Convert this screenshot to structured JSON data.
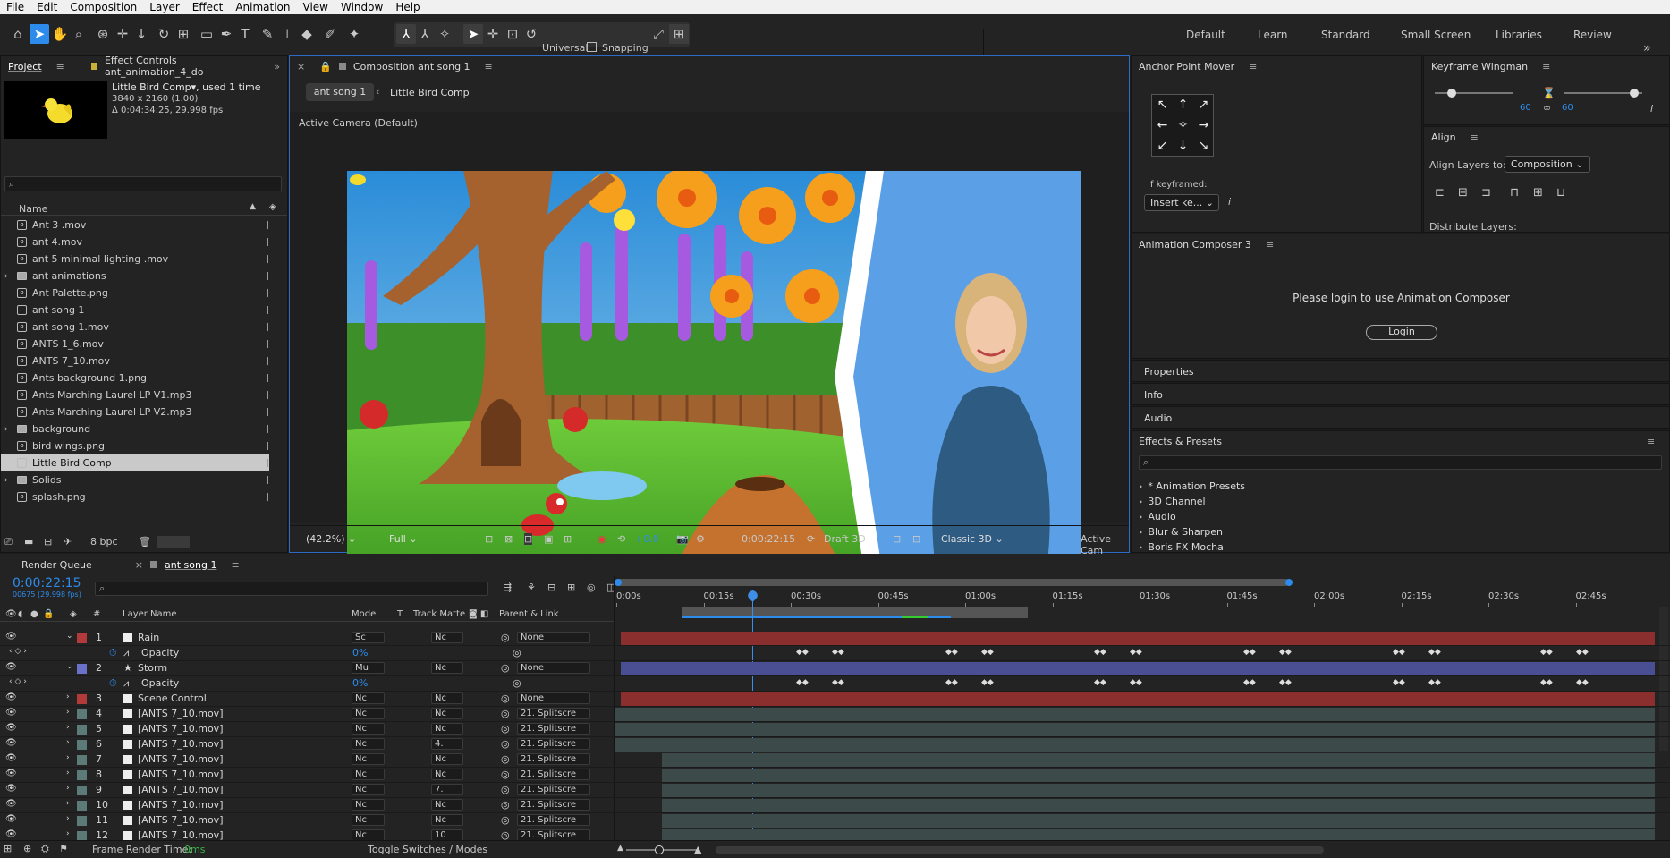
{
  "menu": [
    "File",
    "Edit",
    "Composition",
    "Layer",
    "Effect",
    "Animation",
    "View",
    "Window",
    "Help"
  ],
  "toolbar": {
    "universal_label": "Universal",
    "snapping_label": "Snapping",
    "workspaces": [
      "Default",
      "Learn",
      "Standard",
      "Small Screen",
      "Libraries",
      "Review"
    ]
  },
  "project": {
    "tab_project": "Project",
    "tab_effect_controls": "Effect Controls ant_animation_4_do",
    "comp_name": "Little Bird Comp▾, used 1 time",
    "comp_res": "3840 x 2160 (1.00)",
    "comp_dur": "Δ 0:04:34:25, 29.998 fps",
    "search_placeholder": "",
    "col_name": "Name",
    "items": [
      {
        "name": "Ant 3 .mov",
        "type": "file"
      },
      {
        "name": "ant 4.mov",
        "type": "file"
      },
      {
        "name": "ant 5 minimal lighting .mov",
        "type": "file"
      },
      {
        "name": "ant animations",
        "type": "folder"
      },
      {
        "name": "Ant Palette.png",
        "type": "file"
      },
      {
        "name": "ant song 1",
        "type": "comp"
      },
      {
        "name": "ant song 1.mov",
        "type": "file"
      },
      {
        "name": "ANTS 1_6.mov",
        "type": "file"
      },
      {
        "name": "ANTS 7_10.mov",
        "type": "file"
      },
      {
        "name": "Ants background 1.png",
        "type": "file"
      },
      {
        "name": "Ants Marching Laurel LP V1.mp3",
        "type": "file"
      },
      {
        "name": "Ants Marching Laurel LP V2.mp3",
        "type": "file"
      },
      {
        "name": "background",
        "type": "folder"
      },
      {
        "name": "bird wings.png",
        "type": "file"
      },
      {
        "name": "Little Bird Comp",
        "type": "comp",
        "selected": true
      },
      {
        "name": "Solids",
        "type": "folder"
      },
      {
        "name": "splash.png",
        "type": "file"
      }
    ],
    "bpc": "8 bpc"
  },
  "composition": {
    "tab_label": "Composition ant song 1",
    "breadcrumb_active": "ant song 1",
    "breadcrumb_next": "Little Bird Comp",
    "camera_label": "Active Camera (Default)",
    "zoom": "(42.2%)",
    "resolution": "Full",
    "exposure": "+0.0",
    "timecode": "0:00:22:15",
    "draft": "Draft 3D",
    "renderer": "Classic 3D",
    "view": "Active Cam"
  },
  "anchor_point": {
    "title": "Anchor Point Mover",
    "if_keyframed": "If keyframed:",
    "insert_option": "Insert ke..."
  },
  "keyframe_wingman": {
    "title": "Keyframe Wingman",
    "left_value": "60",
    "right_value": "60",
    "left_fraction": 0.22,
    "right_fraction": 0.9
  },
  "align": {
    "title": "Align",
    "align_to_label": "Align Layers to:",
    "align_to_value": "Composition",
    "distribute_label": "Distribute Layers:"
  },
  "animation_composer": {
    "title": "Animation Composer 3",
    "message": "Please login to use Animation Composer",
    "login": "Login"
  },
  "side_panels": [
    "Properties",
    "Info",
    "Audio"
  ],
  "effects_presets": {
    "title": "Effects & Presets",
    "items": [
      "* Animation Presets",
      "3D Channel",
      "Audio",
      "Blur & Sharpen",
      "Boris FX Mocha"
    ]
  },
  "timeline": {
    "tab_render_queue": "Render Queue",
    "tab_comp": "ant song 1",
    "timecode": "0:00:22:15",
    "frame_info": "00675 (29.998 fps)",
    "col_layer_name": "Layer Name",
    "col_mode": "Mode",
    "col_t": "T",
    "col_track_matte": "Track Matte",
    "col_parent": "Parent & Link",
    "col_hash": "#",
    "ruler": [
      "0:00s",
      "00:15s",
      "00:30s",
      "00:45s",
      "01:00s",
      "01:15s",
      "01:30s",
      "01:45s",
      "02:00s",
      "02:15s",
      "02:30s",
      "02:45s"
    ],
    "footer_render_time_label": "Frame Render Time:",
    "footer_render_time_value": "0ms",
    "footer_toggle": "Toggle Switches / Modes",
    "layers": [
      {
        "num": "1",
        "name": "Rain",
        "mode": "Sc",
        "matte": "Nc",
        "parent": "None",
        "color": "#b23a3a",
        "bar": "#8a2e2e",
        "expanded": true,
        "prop": "Opacity",
        "prop_value": "0%"
      },
      {
        "num": "2",
        "name": "Storm",
        "mode": "Mu",
        "matte": "Nc",
        "parent": "None",
        "color": "#6b70c9",
        "bar": "#4a4f93",
        "expanded": true,
        "prop": "Opacity",
        "prop_value": "0%",
        "star": true
      },
      {
        "num": "3",
        "name": "Scene Control",
        "mode": "Nc",
        "matte": "Nc",
        "parent": "None",
        "color": "#b23a3a",
        "bar": "#8a2e2e"
      },
      {
        "num": "4",
        "name": "[ANTS 7_10.mov]",
        "mode": "Nc",
        "matte": "Nc",
        "parent": "21. Splitscre",
        "color": "#5c7a78",
        "bar": "#3d4a4a"
      },
      {
        "num": "5",
        "name": "[ANTS 7_10.mov]",
        "mode": "Nc",
        "matte": "Nc",
        "parent": "21. Splitscre",
        "color": "#5c7a78",
        "bar": "#3d4a4a"
      },
      {
        "num": "6",
        "name": "[ANTS 7_10.mov]",
        "mode": "Nc",
        "matte": "4.",
        "parent": "21. Splitscre",
        "color": "#5c7a78",
        "bar": "#3d4a4a"
      },
      {
        "num": "7",
        "name": "[ANTS 7_10.mov]",
        "mode": "Nc",
        "matte": "Nc",
        "parent": "21. Splitscre",
        "color": "#5c7a78",
        "bar": "#3d4a4a"
      },
      {
        "num": "8",
        "name": "[ANTS 7_10.mov]",
        "mode": "Nc",
        "matte": "Nc",
        "parent": "21. Splitscre",
        "color": "#5c7a78",
        "bar": "#3d4a4a"
      },
      {
        "num": "9",
        "name": "[ANTS 7_10.mov]",
        "mode": "Nc",
        "matte": "7.",
        "parent": "21. Splitscre",
        "color": "#5c7a78",
        "bar": "#3d4a4a"
      },
      {
        "num": "10",
        "name": "[ANTS 7_10.mov]",
        "mode": "Nc",
        "matte": "Nc",
        "parent": "21. Splitscre",
        "color": "#5c7a78",
        "bar": "#3d4a4a"
      },
      {
        "num": "11",
        "name": "[ANTS 7_10.mov]",
        "mode": "Nc",
        "matte": "Nc",
        "parent": "21. Splitscre",
        "color": "#5c7a78",
        "bar": "#3d4a4a"
      },
      {
        "num": "12",
        "name": "[ANTS 7_10.mov]",
        "mode": "Nc",
        "matte": "10",
        "parent": "21. Splitscre",
        "color": "#5c7a78",
        "bar": "#3d4a4a"
      }
    ]
  },
  "colors": {
    "accent": "#2d8ceb",
    "panel": "#232323",
    "timecode": "#2d8ceb"
  }
}
